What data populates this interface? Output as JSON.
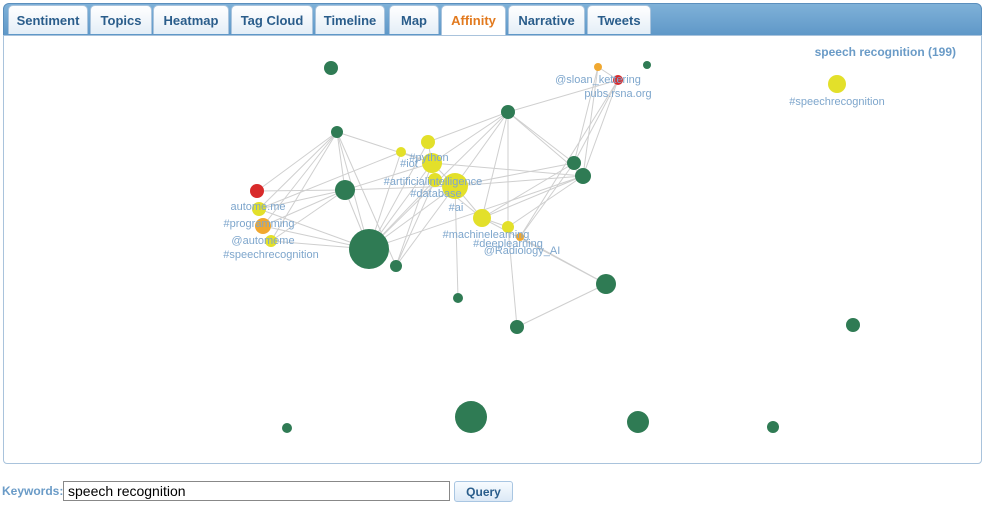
{
  "tabs": [
    {
      "label": "Sentiment",
      "active": false
    },
    {
      "label": "Topics",
      "active": false
    },
    {
      "label": "Heatmap",
      "active": false
    },
    {
      "label": "Tag Cloud",
      "active": false
    },
    {
      "label": "Timeline",
      "active": false
    },
    {
      "label": "Map",
      "active": false
    },
    {
      "label": "Affinity",
      "active": true
    },
    {
      "label": "Narrative",
      "active": false
    },
    {
      "label": "Tweets",
      "active": false
    }
  ],
  "graph": {
    "title": "speech recognition (199)",
    "labels": [
      "@sloan_kettering",
      "pubs.rsna.org",
      "#speechrecognition",
      "#python",
      "#iot",
      "#artificialintelligence",
      "#database",
      "#ai",
      "autome.me",
      "#programming",
      "@automeme",
      "#speechrecognition",
      "#machinelearning",
      "#deeplearning",
      "@Radiology_AI"
    ],
    "colors": {
      "green": "#2f7b54",
      "yellow": "#e3e02a",
      "orange": "#f0a830",
      "red": "#d82a2a",
      "edge": "#cfcfcf",
      "label": "#7ea6cc"
    }
  },
  "search": {
    "label": "Keywords:",
    "value": "speech recognition",
    "button": "Query"
  }
}
